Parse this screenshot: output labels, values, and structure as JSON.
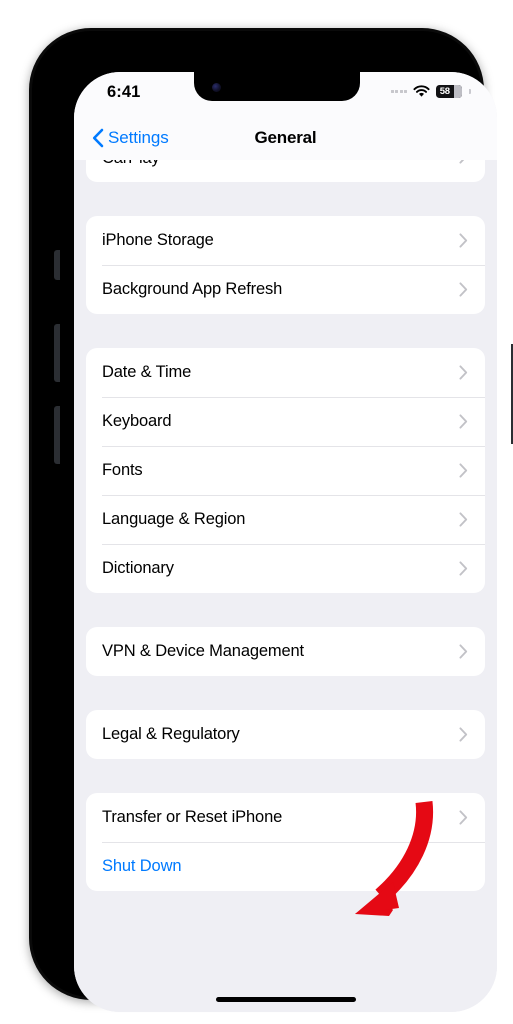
{
  "status_bar": {
    "time": "6:41",
    "cellular_icon": "cellular-dots-icon",
    "wifi_icon": "wifi-icon",
    "battery_icon": "battery-icon",
    "battery_level": "58"
  },
  "nav_bar": {
    "back_icon": "chevron-left-icon",
    "back_label": "Settings",
    "title": "General"
  },
  "groups": [
    {
      "partial_top": true,
      "rows": [
        {
          "label": "CarPlay",
          "chevron": true,
          "style": "default"
        }
      ]
    },
    {
      "partial_top": false,
      "rows": [
        {
          "label": "iPhone Storage",
          "chevron": true,
          "style": "default"
        },
        {
          "label": "Background App Refresh",
          "chevron": true,
          "style": "default"
        }
      ]
    },
    {
      "partial_top": false,
      "rows": [
        {
          "label": "Date & Time",
          "chevron": true,
          "style": "default"
        },
        {
          "label": "Keyboard",
          "chevron": true,
          "style": "default"
        },
        {
          "label": "Fonts",
          "chevron": true,
          "style": "default"
        },
        {
          "label": "Language & Region",
          "chevron": true,
          "style": "default"
        },
        {
          "label": "Dictionary",
          "chevron": true,
          "style": "default"
        }
      ]
    },
    {
      "partial_top": false,
      "rows": [
        {
          "label": "VPN & Device Management",
          "chevron": true,
          "style": "default"
        }
      ]
    },
    {
      "partial_top": false,
      "rows": [
        {
          "label": "Legal & Regulatory",
          "chevron": true,
          "style": "default"
        }
      ]
    },
    {
      "partial_top": false,
      "rows": [
        {
          "label": "Transfer or Reset iPhone",
          "chevron": true,
          "style": "default"
        },
        {
          "label": "Shut Down",
          "chevron": false,
          "style": "blue"
        }
      ]
    }
  ],
  "annotation": {
    "type": "curved-arrow",
    "color": "#e50914",
    "points_to": "Transfer or Reset iPhone"
  },
  "colors": {
    "accent_blue": "#007aff",
    "screen_background": "#efeff4",
    "card_background": "#ffffff",
    "annotation_red": "#e50914"
  }
}
